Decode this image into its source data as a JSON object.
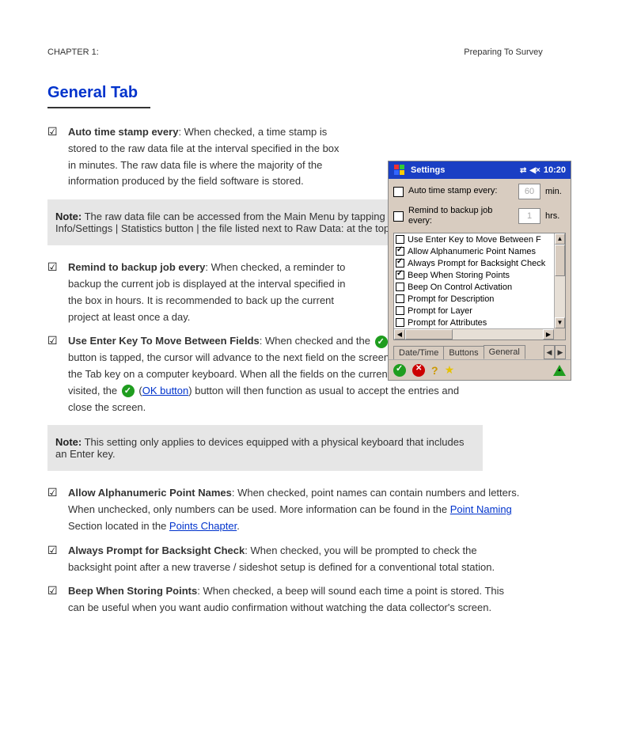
{
  "chapter": {
    "prefix": "CHAPTER 1:",
    "title": "Preparing To Survey"
  },
  "section_title": "General Tab",
  "items": [
    {
      "title": "Auto time stamp every",
      "desc": ": When checked, a time stamp is stored to the raw data file at the interval specified in the box in minutes. The raw data file is where the majority of the information produced by the field software is stored.",
      "narrow": true
    }
  ],
  "notes": [
    "The raw data file can be accessed from the Main Menu by tapping Jobs | Info/Settings | Statistics button | the file listed next to Raw Data: at the top of the list."
  ],
  "items2": [
    {
      "title": "Remind to backup job every",
      "desc": ": When checked, a reminder to backup the current job is displayed at the interval specified in the box in hours. It is recommended to back up the current project at least once a day."
    },
    {
      "title": "Use Enter Key To Move Between Fields",
      "desc_a": ": When checked and the ",
      "icon_text": "<green>",
      "desc_b": " button is tapped, the cursor will advance to the next field on the screen similar to pressing the Tab key on a computer keyboard. When all the fields on the current screen have been visited, the ",
      "desc_c": " button will then function as usual to accept the entries and close the screen."
    }
  ],
  "links": {
    "general_tab": "General Tab",
    "ok_button": "OK button"
  },
  "notes2": [
    "This setting only applies to devices equipped with a physical keyboard that includes an Enter key."
  ],
  "items3": [
    {
      "title": "Allow Alphanumeric Point Names",
      "desc": ": When checked, point names can contain numbers and letters. When unchecked, only numbers can be used. More information can be found in the Point Naming Section located in the Points Chapter."
    },
    {
      "title": "Always Prompt for Backsight Check",
      "desc": ": When checked, you will be prompted to check the backsight point after a new traverse / sideshot setup is defined for a conventional total station."
    },
    {
      "title": "Beep When Storing Points",
      "desc": ": When checked, a beep will sound each time a point is stored. This can be useful when you want audio confirmation without watching the data collector's screen."
    }
  ],
  "links3": {
    "point_naming": "Point Naming",
    "points_chapter": "Points Chapter"
  },
  "device": {
    "title": "Settings",
    "time": "10:20",
    "top_rows": [
      {
        "label": "Auto time stamp every:",
        "value": "60",
        "unit": "min."
      },
      {
        "label": "Remind to backup job every:",
        "value": "1",
        "unit": "hrs."
      }
    ],
    "list": [
      {
        "checked": false,
        "label": "Use Enter Key to Move Between F"
      },
      {
        "checked": true,
        "label": "Allow Alphanumeric Point Names"
      },
      {
        "checked": true,
        "label": "Always Prompt for Backsight Check"
      },
      {
        "checked": true,
        "label": "Beep When Storing Points"
      },
      {
        "checked": false,
        "label": "Beep On Control Activation"
      },
      {
        "checked": false,
        "label": "Prompt for Description"
      },
      {
        "checked": false,
        "label": "Prompt for Layer"
      },
      {
        "checked": false,
        "label": "Prompt for Attributes"
      }
    ],
    "tabs": [
      "Date/Time",
      "Buttons",
      "General"
    ],
    "active_tab": 2
  }
}
